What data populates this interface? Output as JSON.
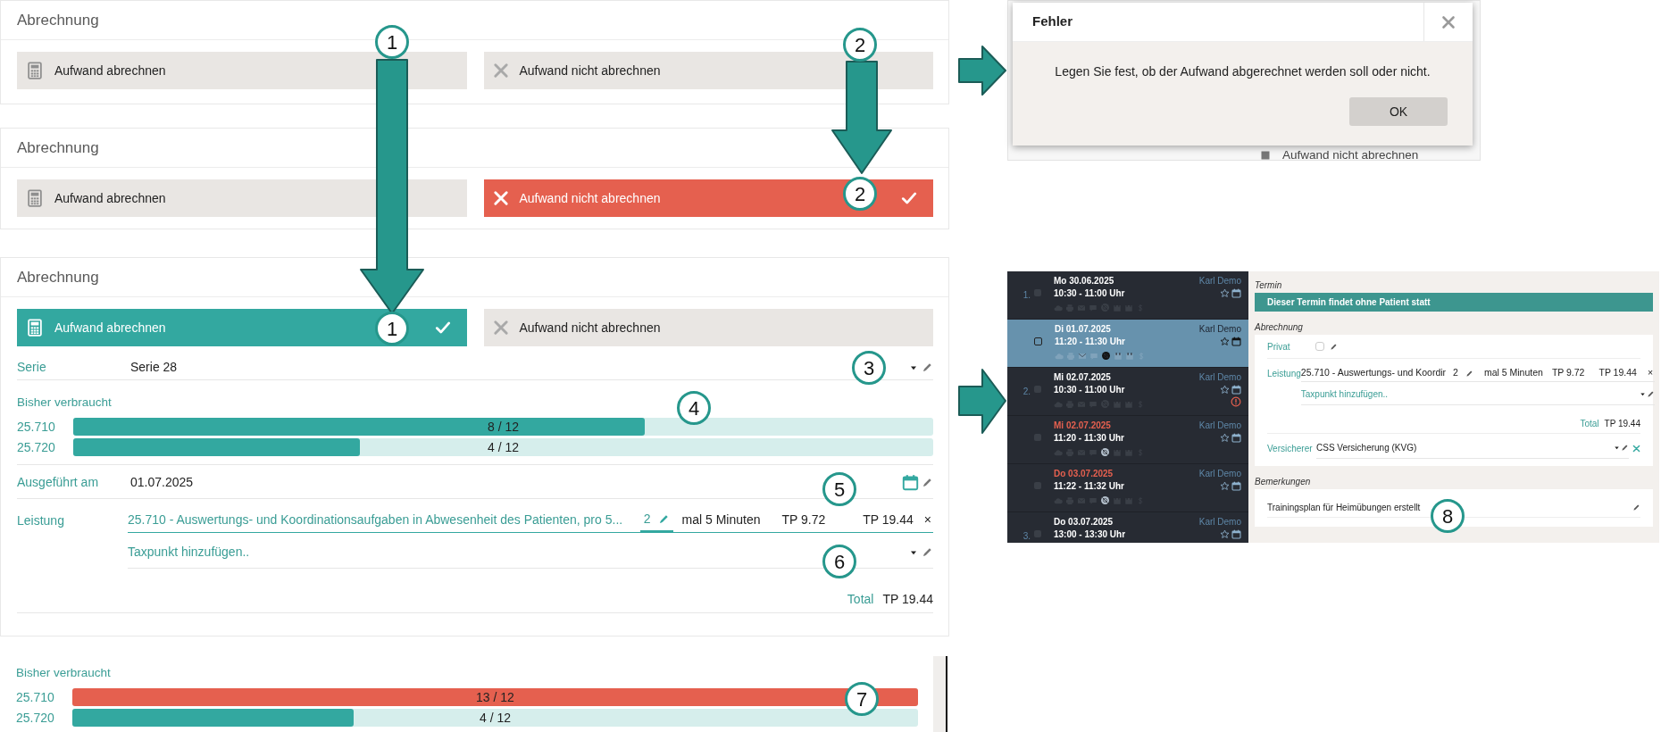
{
  "panel_unset": {
    "title": "Abrechnung",
    "options": [
      {
        "label": "Aufwand abrechnen",
        "kind": "bill",
        "selected": false
      },
      {
        "label": "Aufwand nicht abrechnen",
        "kind": "no_bill",
        "selected": false
      }
    ]
  },
  "panel_no_bill": {
    "title": "Abrechnung",
    "options": [
      {
        "label": "Aufwand abrechnen",
        "kind": "bill",
        "selected": false
      },
      {
        "label": "Aufwand nicht abrechnen",
        "kind": "no_bill",
        "selected": true
      }
    ]
  },
  "panel_bill": {
    "title": "Abrechnung",
    "options": [
      {
        "label": "Aufwand abrechnen",
        "kind": "bill",
        "selected": true
      },
      {
        "label": "Aufwand nicht abrechnen",
        "kind": "no_bill",
        "selected": false
      }
    ],
    "serie": {
      "label": "Serie",
      "value": "Serie 28"
    },
    "consumed": {
      "label": "Bisher verbraucht",
      "bars": [
        {
          "code": "25.710",
          "reading": "8 / 12",
          "level": 0.665,
          "over": false
        },
        {
          "code": "25.720",
          "reading": "4 / 12",
          "level": 0.333,
          "over": false
        }
      ]
    },
    "executed": {
      "label": "Ausgeführt am",
      "value": "01.07.2025"
    },
    "service": {
      "label": "Leistung",
      "text": "25.710 - Auswertungs- und Koordinationsaufgaben in Abwesenheit des Patienten, pro 5...",
      "quantity": "2",
      "unit": "mal 5 Minuten",
      "tp_unit": "TP 9.72",
      "tp_total": "TP 19.44",
      "remove": "×"
    },
    "add_placeholder": "Taxpunkt hinzufügen..",
    "total": {
      "label": "Total",
      "value": "TP 19.44"
    }
  },
  "consumed_over": {
    "label": "Bisher verbraucht",
    "bars": [
      {
        "code": "25.710",
        "reading": "13 / 12",
        "level": 1,
        "over": true
      },
      {
        "code": "25.720",
        "reading": "4 / 12",
        "level": 0.333,
        "over": false
      }
    ]
  },
  "error_dialog": {
    "title": "Fehler",
    "message": "Legen Sie fest, ob der Aufwand abgerechnet werden soll oder nicht.",
    "button": "OK",
    "background_text": "Aufwand nicht abrechnen"
  },
  "appointments": [
    {
      "number": "1.",
      "date": "Mo 30.06.2025",
      "time": "10:30 - 11:00 Uhr",
      "person": "Karl Demo",
      "selected": false,
      "late": false,
      "warning": false,
      "icon_active": false
    },
    {
      "date": "Di 01.07.2025",
      "time": "11:20 - 11:30 Uhr",
      "person": "Karl Demo",
      "selected": true,
      "late": false,
      "warning": false,
      "icon_active": true
    },
    {
      "number": "2.",
      "date": "Mi 02.07.2025",
      "time": "10:30 - 11:00 Uhr",
      "person": "Karl Demo",
      "selected": false,
      "late": false,
      "warning": true,
      "icon_active": false
    },
    {
      "date": "Mi 02.07.2025",
      "time": "11:20 - 11:30 Uhr",
      "person": "Karl Demo",
      "selected": false,
      "late": true,
      "warning": false,
      "icon_active": true
    },
    {
      "date": "Do 03.07.2025",
      "time": "11:22 - 11:32 Uhr",
      "person": "Karl Demo",
      "selected": false,
      "late": true,
      "warning": false,
      "icon_active": true
    },
    {
      "number": "3.",
      "date": "Do 03.07.2025",
      "time": "13:00 - 13:30 Uhr",
      "person": "Karl Demo",
      "selected": false,
      "late": false
    }
  ],
  "detail": {
    "termin_heading": "Termin",
    "banner": "Dieser Termin findet ohne Patient statt",
    "billing_heading": "Abrechnung",
    "privat": {
      "label": "Privat",
      "checked": false
    },
    "service": {
      "label": "Leistung",
      "text": "25.710 - Auswertungs- und Koordir",
      "quantity": "2",
      "unit": "mal 5 Minuten",
      "tp_unit": "TP 9.72",
      "tp_total": "TP 19.44",
      "remove": "×"
    },
    "add_placeholder": "Taxpunkt hinzufügen..",
    "total": {
      "label": "Total",
      "value": "TP 19.44"
    },
    "insurer": {
      "label": "Versicherer",
      "value": "CSS Versicherung (KVG)"
    },
    "remarks_heading": "Bemerkungen",
    "remark": "Trainingsplan für Heimübungen erstellt"
  },
  "markers": [
    {
      "label": "1"
    },
    {
      "label": "2"
    },
    {
      "label": "2"
    },
    {
      "label": "1"
    },
    {
      "label": "3"
    },
    {
      "label": "4"
    },
    {
      "label": "5"
    },
    {
      "label": "6"
    },
    {
      "label": "7"
    },
    {
      "label": "8"
    }
  ]
}
